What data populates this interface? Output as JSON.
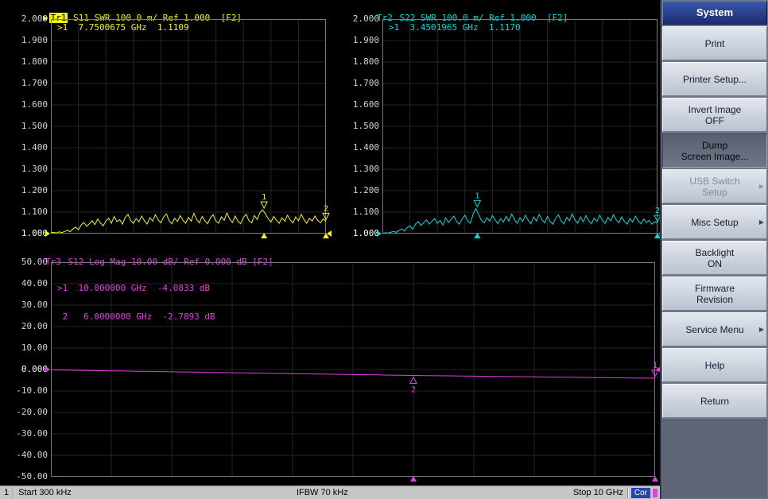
{
  "graphs": {
    "tr1": {
      "name": "Tr1",
      "header": "S11 SWR 100.0 m/ Ref 1.000  [F2]",
      "color": "#f5f500",
      "readout_lines": [
        ">1  7.7500675 GHz  1.1109"
      ],
      "ymin": 1.0,
      "ymax": 2.0,
      "ref_value": 1.0,
      "ylabels": [
        "2.000",
        "1.900",
        "1.800",
        "1.700",
        "1.600",
        "1.500",
        "1.400",
        "1.300",
        "1.200",
        "1.100",
        "1.000"
      ],
      "ref_label_index": 10,
      "markers": [
        {
          "label": "1",
          "x_pct": 77.5,
          "value": 1.1109,
          "label_pos": "above"
        },
        {
          "label": "2",
          "x_pct": 100,
          "value": 1.058,
          "label_pos": "above"
        }
      ],
      "axis_marker_pcts": [
        77.5,
        100
      ],
      "trace": [
        1.004,
        1.006,
        1.003,
        1.008,
        1.005,
        1.01,
        1.016,
        1.009,
        1.022,
        1.03,
        1.018,
        1.04,
        1.052,
        1.034,
        1.046,
        1.06,
        1.042,
        1.068,
        1.05,
        1.036,
        1.058,
        1.072,
        1.048,
        1.08,
        1.056,
        1.066,
        1.044,
        1.075,
        1.09,
        1.062,
        1.048,
        1.07,
        1.055,
        1.082,
        1.06,
        1.045,
        1.074,
        1.058,
        1.088,
        1.064,
        1.05,
        1.078,
        1.092,
        1.06,
        1.046,
        1.072,
        1.056,
        1.084,
        1.062,
        1.048,
        1.076,
        1.058,
        1.094,
        1.066,
        1.05,
        1.08,
        1.06,
        1.046,
        1.074,
        1.088,
        1.058,
        1.048,
        1.078,
        1.062,
        1.096,
        1.068,
        1.052,
        1.082,
        1.058,
        1.046,
        1.076,
        1.09,
        1.06,
        1.05,
        1.084,
        1.066,
        1.098,
        1.1109,
        1.092,
        1.07,
        1.054,
        1.08,
        1.062,
        1.048,
        1.074,
        1.058,
        1.086,
        1.064,
        1.05,
        1.078,
        1.06,
        1.09,
        1.066,
        1.048,
        1.072,
        1.058,
        1.082,
        1.062,
        1.05,
        1.068,
        1.058
      ]
    },
    "tr2": {
      "name": "Tr2",
      "header": "S22 SWR 100.0 m/ Ref 1.000  [F2]",
      "color": "#00dcdc",
      "readout_lines": [
        ">1  3.4501965 GHz  1.1170"
      ],
      "ymin": 1.0,
      "ymax": 2.0,
      "ref_value": 1.0,
      "ylabels": [
        "2.000",
        "1.900",
        "1.800",
        "1.700",
        "1.600",
        "1.500",
        "1.400",
        "1.300",
        "1.200",
        "1.100",
        "1.000"
      ],
      "ref_label_index": 10,
      "markers": [
        {
          "label": "1",
          "x_pct": 34.5,
          "value": 1.117,
          "label_pos": "above"
        },
        {
          "label": "2",
          "x_pct": 100,
          "value": 1.048,
          "label_pos": "above"
        }
      ],
      "axis_marker_pcts": [
        34.5,
        100
      ],
      "trace": [
        1.002,
        1.004,
        1.003,
        1.006,
        1.01,
        1.006,
        1.014,
        1.022,
        1.012,
        1.028,
        1.036,
        1.02,
        1.044,
        1.056,
        1.038,
        1.05,
        1.064,
        1.044,
        1.058,
        1.07,
        1.048,
        1.062,
        1.04,
        1.074,
        1.052,
        1.066,
        1.082,
        1.056,
        1.044,
        1.068,
        1.086,
        1.06,
        1.048,
        1.092,
        1.117,
        1.088,
        1.062,
        1.05,
        1.074,
        1.058,
        1.084,
        1.064,
        1.046,
        1.07,
        1.054,
        1.08,
        1.058,
        1.092,
        1.066,
        1.048,
        1.074,
        1.056,
        1.086,
        1.062,
        1.046,
        1.078,
        1.058,
        1.09,
        1.064,
        1.05,
        1.08,
        1.056,
        1.044,
        1.072,
        1.088,
        1.058,
        1.046,
        1.076,
        1.06,
        1.092,
        1.064,
        1.048,
        1.078,
        1.054,
        1.084,
        1.06,
        1.046,
        1.072,
        1.056,
        1.086,
        1.062,
        1.048,
        1.076,
        1.058,
        1.088,
        1.064,
        1.05,
        1.078,
        1.056,
        1.044,
        1.07,
        1.054,
        1.082,
        1.06,
        1.046,
        1.068,
        1.052,
        1.062,
        1.044,
        1.056,
        1.048
      ]
    },
    "tr3": {
      "name": "Tr3",
      "header": "S12 Log Mag 10.00 dB/ Ref 0.000 dB [F2]",
      "color": "#e53ce5",
      "readout_lines": [
        ">1  10.000000 GHz  -4.0833 dB",
        " 2   6.0000000 GHz  -2.7893 dB"
      ],
      "ymin": -50.0,
      "ymax": 50.0,
      "ref_value": 0.0,
      "ylabels": [
        "50.00",
        "40.00",
        "30.00",
        "20.00",
        "10.00",
        "0.000",
        "-10.00",
        "-20.00",
        "-30.00",
        "-40.00",
        "-50.00"
      ],
      "ref_label_index": 5,
      "markers": [
        {
          "label": "1",
          "x_pct": 100,
          "value": -4.0833,
          "label_pos": "above"
        },
        {
          "label": "2",
          "x_pct": 60,
          "value": -2.7893,
          "label_pos": "below"
        }
      ],
      "axis_marker_pcts": [
        60,
        100
      ],
      "trace": [
        -0.2,
        -0.29,
        -0.37,
        -0.46,
        -0.55,
        -0.63,
        -0.72,
        -0.8,
        -0.89,
        -0.98,
        -1.06,
        -1.15,
        -1.24,
        -1.32,
        -1.41,
        -1.5,
        -1.58,
        -1.67,
        -1.75,
        -1.84,
        -1.93,
        -2.01,
        -2.1,
        -2.19,
        -2.27,
        -2.36,
        -2.44,
        -2.53,
        -2.62,
        -2.7,
        -2.79,
        -2.85,
        -2.92,
        -2.98,
        -3.05,
        -3.11,
        -3.18,
        -3.24,
        -3.31,
        -3.37,
        -3.44,
        -3.5,
        -3.56,
        -3.63,
        -3.69,
        -3.76,
        -3.82,
        -3.89,
        -3.95,
        -4.02,
        -4.08
      ]
    }
  },
  "status_bar": {
    "channel": "1",
    "start": "Start 300 kHz",
    "ifbw": "IFBW 70 kHz",
    "stop": "Stop 10 GHz",
    "correction": "Cor"
  },
  "menu": {
    "title": "System",
    "buttons": [
      {
        "lines": [
          "System"
        ],
        "type": "header"
      },
      {
        "lines": [
          "Print"
        ]
      },
      {
        "lines": [
          "Printer Setup..."
        ]
      },
      {
        "lines": [
          "Invert Image",
          "OFF"
        ]
      },
      {
        "lines": [
          "Dump",
          "Screen Image..."
        ],
        "state": "pressed"
      },
      {
        "lines": [
          "USB Switch",
          "Setup"
        ],
        "state": "disabled",
        "arrow": true
      },
      {
        "lines": [
          "Misc Setup"
        ],
        "arrow": true
      },
      {
        "lines": [
          "Backlight",
          "ON"
        ]
      },
      {
        "lines": [
          "Firmware",
          "Revision"
        ]
      },
      {
        "lines": [
          "Service Menu"
        ],
        "arrow": true
      },
      {
        "lines": [
          "Help"
        ]
      },
      {
        "lines": [
          "Return"
        ]
      }
    ]
  }
}
